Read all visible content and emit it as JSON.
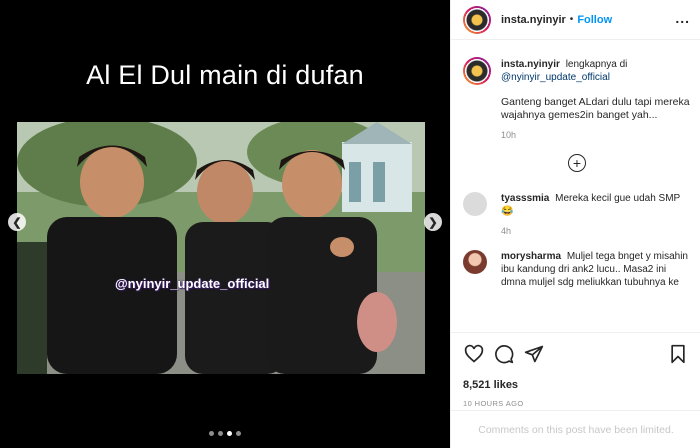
{
  "media": {
    "caption_title": "Al El Dul main di dufan",
    "watermark": "@nyinyir_update_official",
    "dots_total": 4,
    "dots_active": 3
  },
  "header": {
    "username": "insta.nyinyir",
    "separator": "•",
    "follow_label": "Follow",
    "more_label": "..."
  },
  "caption": {
    "username": "insta.nyinyir",
    "text_prefix": "lengkapnya di",
    "link": "@nyinyir_update_official",
    "body": "Ganteng banget ALdari dulu tapi mereka wajahnya gemes2in banget yah...",
    "time": "10h"
  },
  "load_more": "+",
  "comments": [
    {
      "username": "tyasssmia",
      "text": "Mereka kecil gue udah SMP 😂",
      "time": "4h"
    },
    {
      "username": "morysharma",
      "text": "Muljel tega bnget y misahin ibu kandung dri ank2 lucu.. Masa2 ini dmna muljel sdg meliukkan tubuhnya ke"
    }
  ],
  "likes": "8,521 likes",
  "post_time": "10 HOURS AGO",
  "comments_limited": "Comments on this post have been limited."
}
